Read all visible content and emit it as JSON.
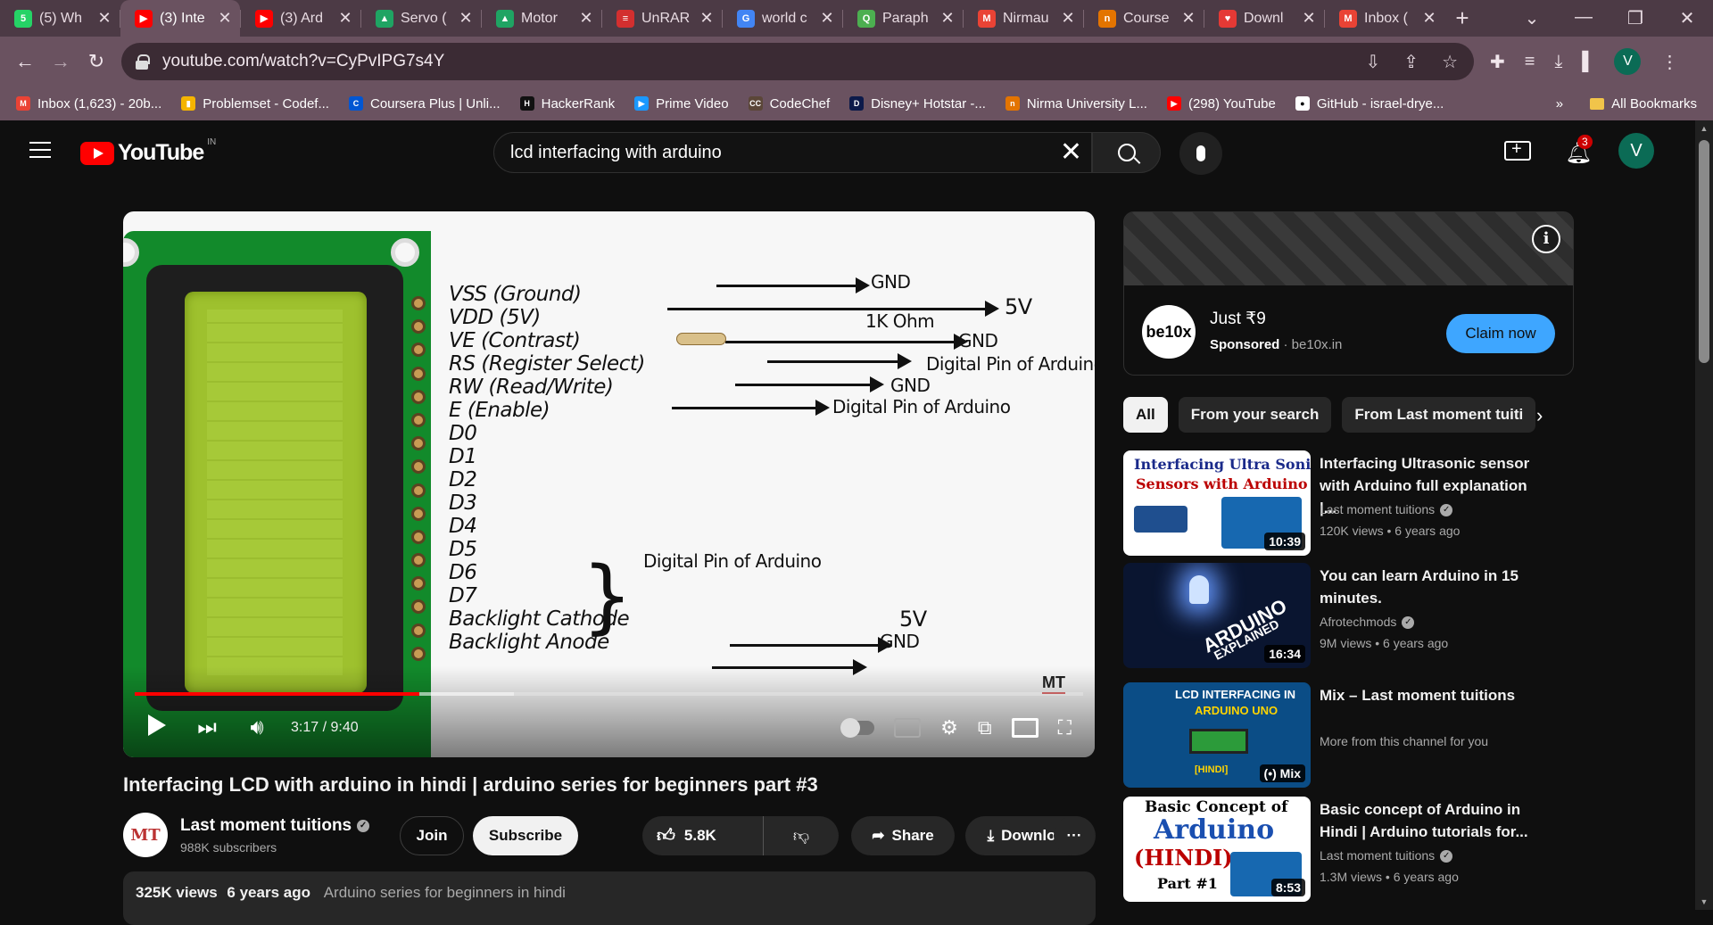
{
  "browser": {
    "tabs": [
      {
        "title": "(5) Wh",
        "favicon_color": "#25d366",
        "favicon_glyph": "5",
        "active": false
      },
      {
        "title": "(3) Inte",
        "favicon_color": "#ff0000",
        "favicon_glyph": "▶",
        "active": true
      },
      {
        "title": "(3) Ard",
        "favicon_color": "#ff0000",
        "favicon_glyph": "▶",
        "active": false
      },
      {
        "title": "Servo (",
        "favicon_color": "#1fa463",
        "favicon_glyph": "▲",
        "active": false
      },
      {
        "title": "Motor",
        "favicon_color": "#1fa463",
        "favicon_glyph": "▲",
        "active": false
      },
      {
        "title": "UnRAR",
        "favicon_color": "#d32f2f",
        "favicon_glyph": "≡",
        "active": false
      },
      {
        "title": "world c",
        "favicon_color": "#4285f4",
        "favicon_glyph": "G",
        "active": false
      },
      {
        "title": "Paraph",
        "favicon_color": "#4caf50",
        "favicon_glyph": "Q",
        "active": false
      },
      {
        "title": "Nirmau",
        "favicon_color": "#ea4335",
        "favicon_glyph": "M",
        "active": false
      },
      {
        "title": "Course",
        "favicon_color": "#e37400",
        "favicon_glyph": "n",
        "active": false
      },
      {
        "title": "Downl",
        "favicon_color": "#e53935",
        "favicon_glyph": "♥",
        "active": false
      },
      {
        "title": "Inbox (",
        "favicon_color": "#ea4335",
        "favicon_glyph": "M",
        "active": false
      }
    ],
    "url": "youtube.com/watch?v=CyPvIPG7s4Y",
    "profile_initial": "V",
    "bookmarks": [
      {
        "label": "Inbox (1,623) - 20b...",
        "color": "#ea4335",
        "glyph": "M"
      },
      {
        "label": "Problemset - Codef...",
        "color": "#f4b400",
        "glyph": "▮"
      },
      {
        "label": "Coursera Plus | Unli...",
        "color": "#0056d2",
        "glyph": "C"
      },
      {
        "label": "HackerRank",
        "color": "#111111",
        "glyph": "H"
      },
      {
        "label": "Prime Video",
        "color": "#1a98ff",
        "glyph": "▶"
      },
      {
        "label": "CodeChef",
        "color": "#5b4638",
        "glyph": "CC"
      },
      {
        "label": "Disney+ Hotstar -...",
        "color": "#0c1a4a",
        "glyph": "D"
      },
      {
        "label": "Nirma University L...",
        "color": "#e37400",
        "glyph": "n"
      },
      {
        "label": "(298) YouTube",
        "color": "#ff0000",
        "glyph": "▶"
      },
      {
        "label": "GitHub - israel-drye...",
        "color": "#ffffff",
        "glyph": "●"
      }
    ],
    "bookmarks_overflow": "»",
    "all_bookmarks": "All Bookmarks"
  },
  "youtube": {
    "logo_text": "YouTube",
    "country": "IN",
    "search_query": "lcd interfacing with arduino",
    "notifications": "3",
    "avatar_initial": "V"
  },
  "video": {
    "slide": {
      "labels": [
        "VSS (Ground)",
        "VDD (5V)",
        "VE (Contrast)",
        "RS (Register Select)",
        "RW (Read/Write)",
        "E (Enable)",
        "D0",
        "D1",
        "D2",
        "D3",
        "D4",
        "D5",
        "D6",
        "D7",
        "Backlight Cathode",
        "Backlight Anode"
      ],
      "notes": {
        "vss": "GND",
        "vdd": "5V",
        "resistor": "1K Ohm",
        "ve_gnd": "GND",
        "rs": "Digital Pin of Arduino",
        "rw": "GND",
        "e": "Digital Pin of Arduino",
        "data_pins": "Digital Pin of Arduino",
        "cathode": "5V",
        "anode": "GND"
      }
    },
    "time_display": "3:17 / 9:40",
    "progress_played": 0.3,
    "progress_buffered": 0.4,
    "title": "Interfacing LCD with arduino in hindi | arduino series for beginners part #3",
    "channel": {
      "name": "Last moment tuitions",
      "subscribers": "988K subscribers",
      "avatar_text": "MT"
    },
    "actions": {
      "join": "Join",
      "subscribe": "Subscribe",
      "likes": "5.8K",
      "share": "Share",
      "download": "Download",
      "more": "···"
    },
    "description": {
      "views": "325K views",
      "age": "6 years ago",
      "playlist": "Arduino series for beginners in hindi"
    }
  },
  "ad": {
    "logo_text": "be10x",
    "title": "Just ₹9",
    "sponsored": "Sponsored",
    "domain": "· be10x.in",
    "cta": "Claim now"
  },
  "chips": [
    "All",
    "From your search",
    "From Last moment tuiti"
  ],
  "recommendations": [
    {
      "title": "Interfacing Ultrasonic sensor with Arduino full explanation |...",
      "channel": "Last moment tuitions",
      "verified": true,
      "meta": "120K views  • 6 years ago",
      "duration": "10:39",
      "thumb_bg": "#ffffff",
      "thumb_line1": "Interfacing Ultra Sonic",
      "thumb_line2": "Sensors with Arduino"
    },
    {
      "title": "You can learn Arduino in 15 minutes.",
      "channel": "Afrotechmods",
      "verified": true,
      "meta": "9M views  • 6 years ago",
      "duration": "16:34",
      "thumb_bg": "#0a1530",
      "thumb_line1": "ARDUINO",
      "thumb_line2": "EXPLAINED"
    },
    {
      "title": "Mix – Last moment tuitions",
      "channel": "More from this channel for you",
      "verified": false,
      "meta": "",
      "duration": "(•) Mix",
      "thumb_bg": "#0b4d86",
      "thumb_line1": "LCD INTERFACING IN",
      "thumb_line2": "ARDUINO UNO",
      "thumb_line3": "[HINDI]"
    },
    {
      "title": "Basic concept of Arduino in Hindi | Arduino tutorials for...",
      "channel": "Last moment tuitions",
      "verified": true,
      "meta": "1.3M views  • 6 years ago",
      "duration": "8:53",
      "thumb_bg": "#ffffff",
      "thumb_line1": "Basic Concept of",
      "thumb_line2": "Arduino",
      "thumb_line3": "(HINDI)",
      "thumb_line4": "Part #1"
    }
  ]
}
